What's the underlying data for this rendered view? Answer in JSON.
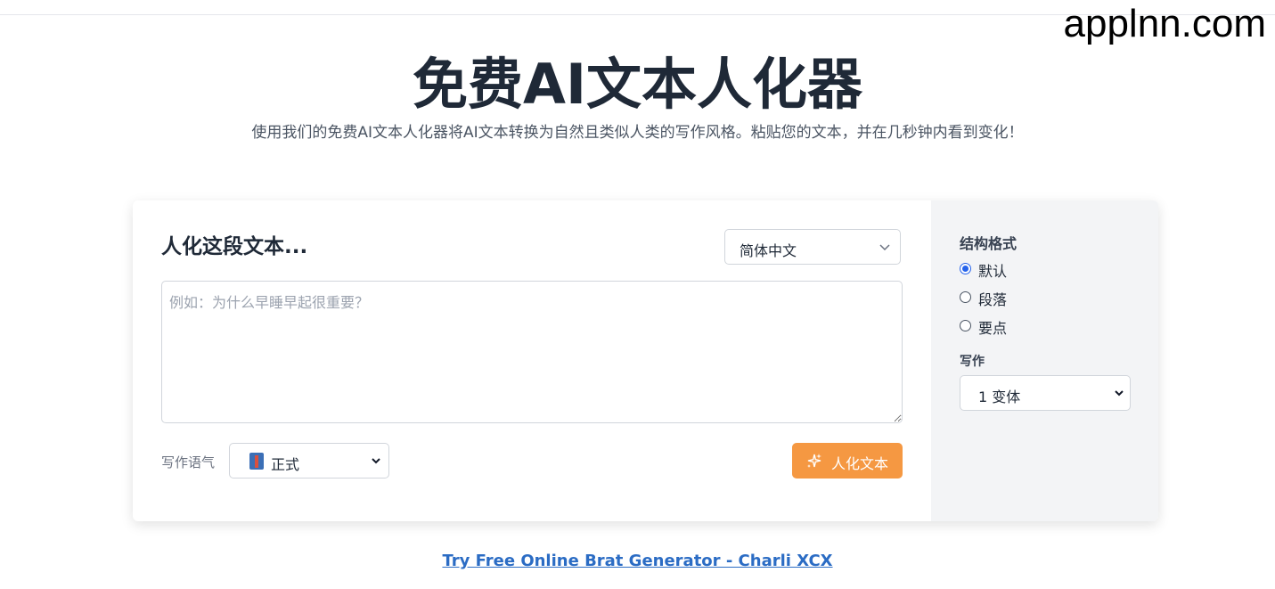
{
  "watermark": "applnn.com",
  "hero": {
    "title": "免费AI文本人化器",
    "subtitle": "使用我们的免费AI文本人化器将AI文本转换为自然且类似人类的写作风格。粘贴您的文本，并在几秒钟内看到变化！"
  },
  "editor": {
    "heading": "人化这段文本...",
    "language": "简体中文",
    "placeholder": "例如：为什么早睡早起很重要？",
    "tone_label": "写作语气",
    "tone_value": "正式",
    "tone_icon": "necktie-emoji-icon",
    "submit_label": "人化文本",
    "submit_icon": "sparkles-icon",
    "accent_color": "#f59842"
  },
  "options": {
    "format_heading": "结构格式",
    "formats": [
      {
        "label": "默认",
        "checked": true
      },
      {
        "label": "段落",
        "checked": false
      },
      {
        "label": "要点",
        "checked": false
      }
    ],
    "writing_label": "写作",
    "variants_value": "1 变体"
  },
  "footer": {
    "link_text": "Try Free Online Brat Generator - Charli XCX",
    "link_color": "#2b6cc4"
  }
}
